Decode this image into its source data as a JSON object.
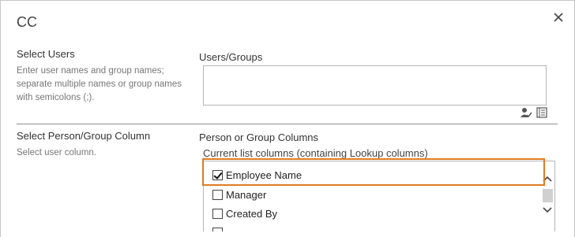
{
  "dialog": {
    "title": "CC"
  },
  "select_users": {
    "label": "Select Users",
    "description_lines": [
      "Enter user names and group names;",
      "separate multiple names or group names",
      "with semicolons (;)."
    ],
    "field_label": "Users/Groups",
    "field_value": ""
  },
  "select_column": {
    "label": "Select Person/Group Column",
    "description": "Select user column.",
    "field_label": "Person or Group Columns",
    "list_caption": "Current list columns (containing Lookup columns)",
    "options": [
      {
        "label": "Employee Name",
        "checked": true
      },
      {
        "label": "Manager",
        "checked": false
      },
      {
        "label": "Created By",
        "checked": false
      }
    ]
  },
  "icons": {
    "close": "close-icon",
    "check_names": "check-names-icon",
    "browse": "address-book-icon",
    "scroll_up": "chevron-up-icon",
    "scroll_down": "chevron-down-icon"
  },
  "colors": {
    "highlight": "#e07b22",
    "divider": "#8f8f8f",
    "border": "#b5b5b5"
  }
}
